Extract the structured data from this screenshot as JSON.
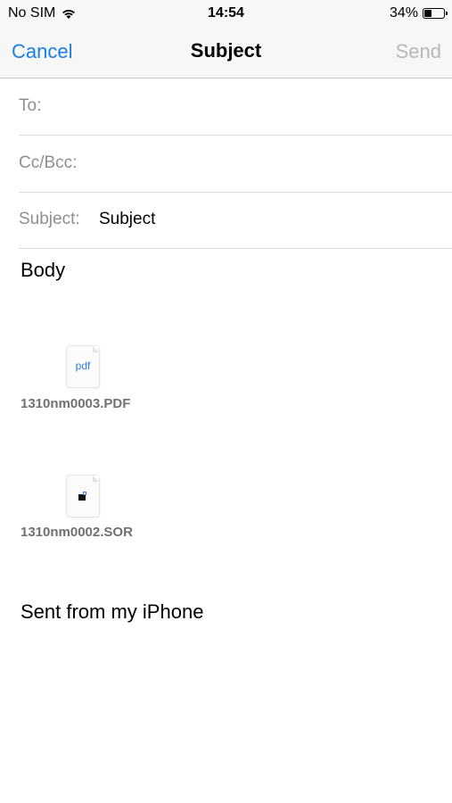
{
  "status_bar": {
    "carrier": "No SIM",
    "time": "14:54",
    "battery_percent": "34%",
    "battery_level": 0.34
  },
  "nav": {
    "cancel_label": "Cancel",
    "title": "Subject",
    "send_label": "Send",
    "accent_color": "#1a7ee6",
    "disabled_color": "#b7b7bc"
  },
  "fields": {
    "to_label": "To:",
    "to_value": "",
    "cc_label": "Cc/Bcc:",
    "cc_value": "",
    "subject_label": "Subject:",
    "subject_value": "Subject"
  },
  "body": {
    "text": "Body",
    "attachments": [
      {
        "icon": "pdf-file-icon",
        "icon_text": "pdf",
        "filename": "1310nm0003.PDF"
      },
      {
        "icon": "generic-file-icon",
        "filename": "1310nm0002.SOR"
      }
    ],
    "signature": "Sent from my iPhone"
  }
}
